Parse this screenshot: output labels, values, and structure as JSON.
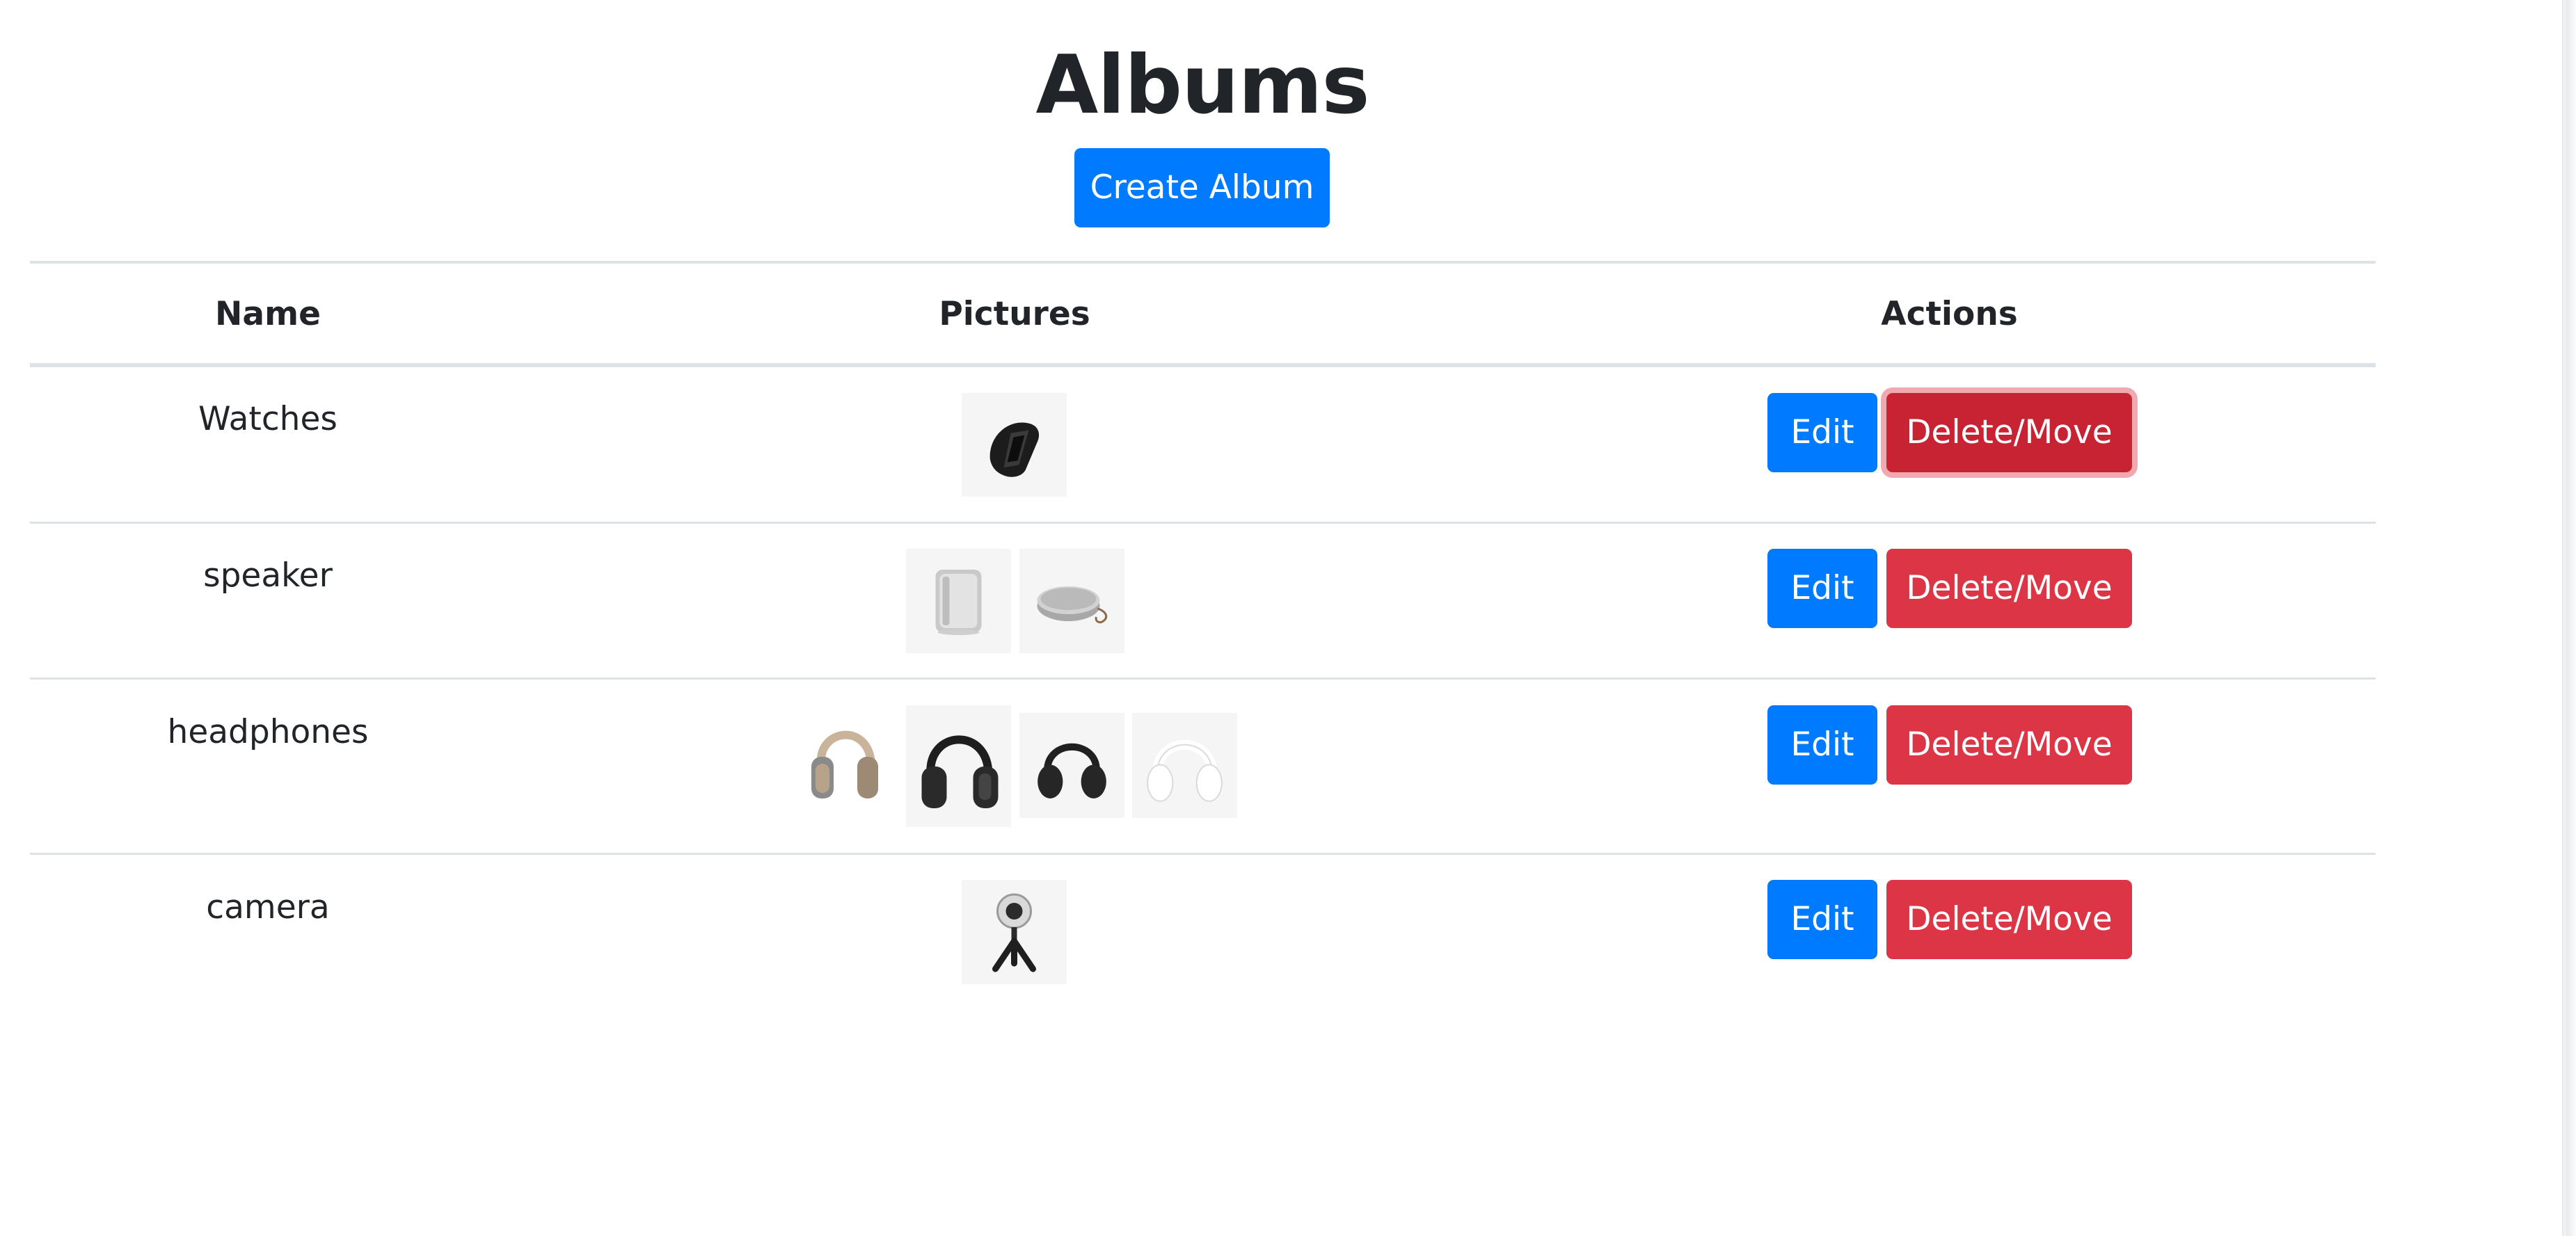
{
  "page": {
    "title": "Albums"
  },
  "toolbar": {
    "create_label": "Create Album"
  },
  "table": {
    "headers": {
      "name": "Name",
      "pictures": "Pictures",
      "actions": "Actions"
    },
    "rows": [
      {
        "name": "Watches",
        "pictures": [
          "fitness-band-photo"
        ],
        "edit_label": "Edit",
        "delete_label": "Delete/Move"
      },
      {
        "name": "speaker",
        "pictures": [
          "box-speaker-photo",
          "round-speaker-photo"
        ],
        "edit_label": "Edit",
        "delete_label": "Delete/Move"
      },
      {
        "name": "headphones",
        "pictures": [
          "beige-headphones-photo",
          "black-over-ear-headphones-photo",
          "black-on-ear-headphones-photo",
          "white-headphones-photo"
        ],
        "edit_label": "Edit",
        "delete_label": "Delete/Move"
      },
      {
        "name": "camera",
        "pictures": [
          "360-camera-photo"
        ],
        "edit_label": "Edit",
        "delete_label": "Delete/Move"
      }
    ]
  },
  "colors": {
    "primary": "#007bff",
    "danger": "#dc3545",
    "danger_focused": "#c82333",
    "text": "#212529",
    "border": "#dee2e6"
  }
}
